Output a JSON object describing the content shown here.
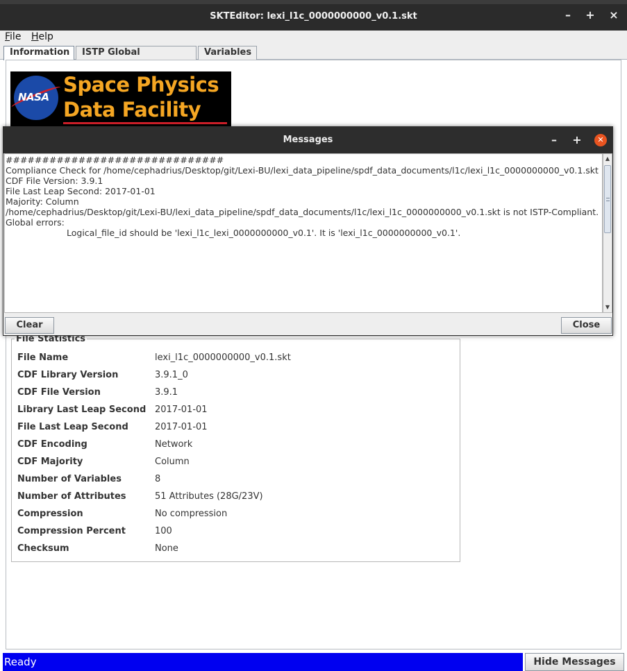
{
  "window": {
    "title": "SKTEditor: lexi_l1c_0000000000_v0.1.skt",
    "minimize_glyph": "–",
    "maximize_glyph": "+",
    "close_glyph": "×"
  },
  "menu": {
    "file_mnemonic": "F",
    "file_rest": "ile",
    "help_mnemonic": "H",
    "help_rest": "elp"
  },
  "tabs": [
    {
      "label": "Information",
      "active": true
    },
    {
      "label": "ISTP Global Attributes",
      "active": false
    },
    {
      "label": "Variables",
      "active": false
    }
  ],
  "logo": {
    "meatball_text": "NASA",
    "line1": "Space Physics",
    "line2": "Data Facility"
  },
  "file_statistics": {
    "title": "File Statistics",
    "rows": [
      {
        "label": "File Name",
        "value": "lexi_l1c_0000000000_v0.1.skt"
      },
      {
        "label": "CDF Library Version",
        "value": "3.9.1_0"
      },
      {
        "label": "CDF File Version",
        "value": "3.9.1"
      },
      {
        "label": "Library Last Leap Second",
        "value": "2017-01-01"
      },
      {
        "label": "File Last Leap Second",
        "value": "2017-01-01"
      },
      {
        "label": "CDF Encoding",
        "value": "Network"
      },
      {
        "label": "CDF Majority",
        "value": "Column"
      },
      {
        "label": "Number of Variables",
        "value": "8"
      },
      {
        "label": "Number of Attributes",
        "value": "51 Attributes (28G/23V)"
      },
      {
        "label": "Compression",
        "value": "No compression"
      },
      {
        "label": "Compression Percent",
        "value": "100"
      },
      {
        "label": "Checksum",
        "value": "None"
      }
    ]
  },
  "messages_dialog": {
    "title": "Messages",
    "minimize_glyph": "–",
    "maximize_glyph": "+",
    "close_glyph": "✕",
    "lines": [
      "##############################",
      "Compliance Check for /home/cephadrius/Desktop/git/Lexi-BU/lexi_data_pipeline/spdf_data_documents/l1c/lexi_l1c_0000000000_v0.1.skt",
      "CDF File Version: 3.9.1",
      "File Last Leap Second: 2017-01-01",
      "Majority: Column",
      "/home/cephadrius/Desktop/git/Lexi-BU/lexi_data_pipeline/spdf_data_documents/l1c/lexi_l1c_0000000000_v0.1.skt is not ISTP-Compliant.",
      "Global errors:",
      "Logical_file_id should be 'lexi_l1c_lexi_0000000000_v0.1'.  It is 'lexi_l1c_0000000000_v0.1'."
    ],
    "clear_label": "Clear",
    "close_label": "Close",
    "scroll_up_glyph": "▲",
    "scroll_down_glyph": "▼"
  },
  "status": {
    "text": "Ready",
    "hide_messages_label": "Hide Messages"
  },
  "colors": {
    "status_bar": "#0000f0",
    "logo_orange": "#f5a623",
    "close_accent": "#e95420"
  }
}
